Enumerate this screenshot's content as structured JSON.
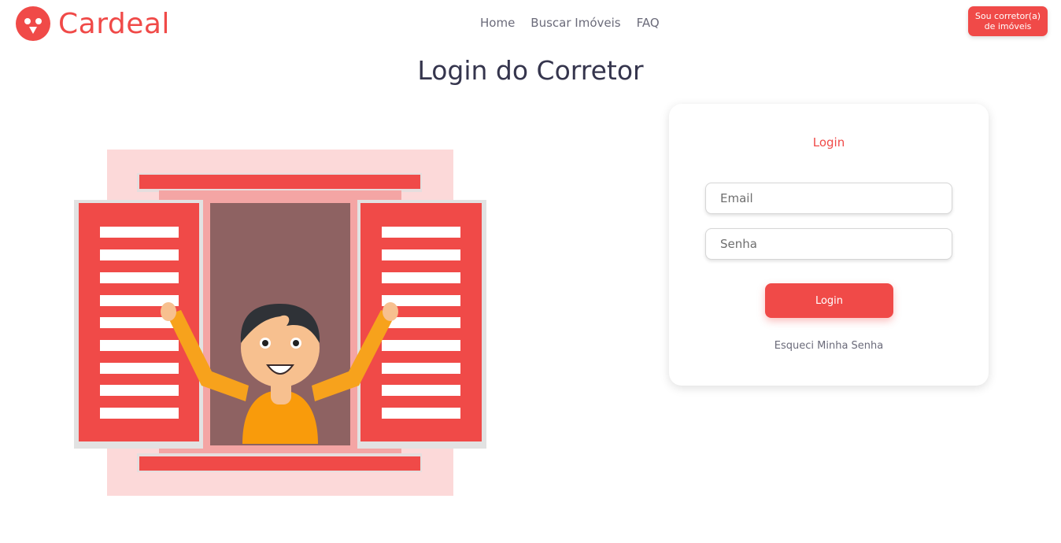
{
  "brand": {
    "name": "Cardeal",
    "accent": "#f04a48"
  },
  "nav": {
    "items": [
      "Home",
      "Buscar Imóveis",
      "FAQ"
    ]
  },
  "realtor_button": {
    "line1": "Sou corretor(a)",
    "line2": "de imóveis"
  },
  "page": {
    "title": "Login do Corretor"
  },
  "illustration": {
    "icon": "person-at-window-illustration"
  },
  "login_card": {
    "title": "Login",
    "email_placeholder": "Email",
    "password_placeholder": "Senha",
    "submit_label": "Login",
    "forgot_label": "Esqueci Minha Senha"
  }
}
